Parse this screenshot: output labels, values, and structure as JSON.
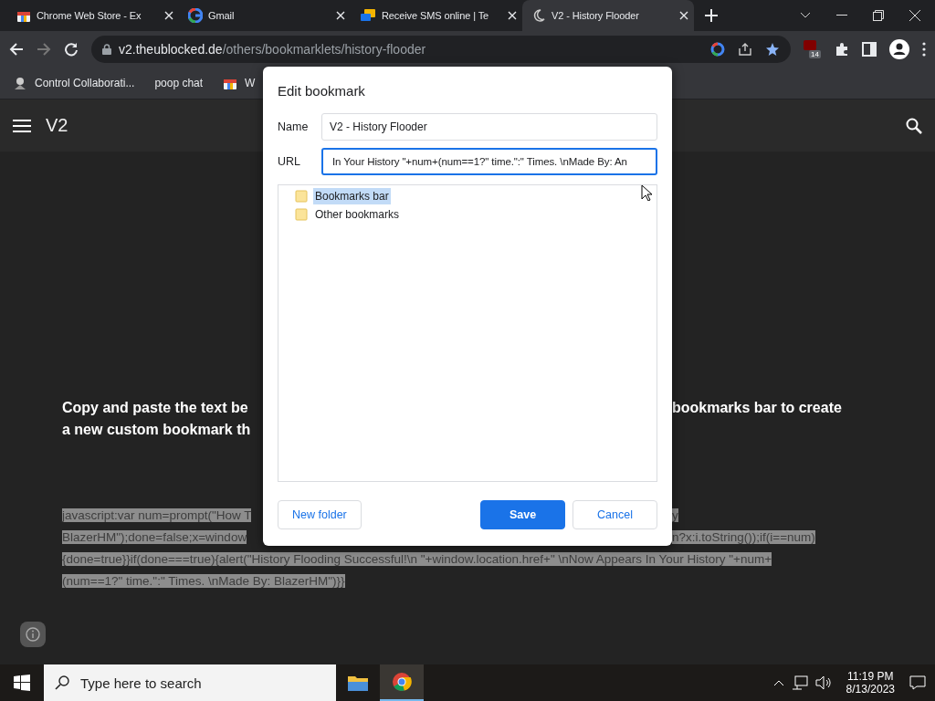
{
  "browser": {
    "tabs": [
      {
        "title": "Chrome Web Store - Ex",
        "kind": "store",
        "selected": false
      },
      {
        "title": "Gmail",
        "kind": "google",
        "selected": false
      },
      {
        "title": "Receive SMS online | Te",
        "kind": "sms",
        "selected": false
      },
      {
        "title": "V2 - History Flooder",
        "kind": "moon",
        "selected": true
      }
    ],
    "address": {
      "domain": "v2.theublocked.de",
      "path": "/others/bookmarklets/history-flooder"
    },
    "extension_badge": "14",
    "bookmarks": [
      {
        "label": "Control Collaborati...",
        "kind": "logo"
      },
      {
        "label": "poop chat",
        "kind": "plain"
      },
      {
        "label": "W",
        "kind": "store"
      }
    ]
  },
  "page": {
    "title": "V2",
    "instructions": [
      {
        "left": "Copy and paste the text be",
        "right": "bookmarks bar to create"
      },
      {
        "left": "a new custom bookmark th"
      }
    ],
    "code_lines": [
      {
        "left": "javascript:var num=prompt(\"How T",
        "right": "y"
      },
      {
        "left": "BlazerHM\");done=false;x=window",
        "right": "n?x:i.toString());if(i==num)"
      },
      {
        "left": "{done=true}}if(done===true){alert(\"History Flooding Successful!\\n \"+window.location.href+\" \\nNow Appears In Your History \"+num+"
      },
      {
        "left": "(num==1?\" time.\":\" Times. \\nMade By: BlazerHM\")}}"
      }
    ]
  },
  "dialog": {
    "title": "Edit bookmark",
    "fields": [
      {
        "label": "Name",
        "value": "V2 - History Flooder",
        "focused": false
      },
      {
        "label": "URL",
        "value": "In Your History \"+num+(num==1?\" time.\":\" Times. \\nMade By: An",
        "focused": true
      }
    ],
    "folders": [
      {
        "label": "Bookmarks bar",
        "selected": true
      },
      {
        "label": "Other bookmarks",
        "selected": false
      }
    ],
    "buttons": [
      {
        "label": "New folder",
        "kind": "secondary"
      },
      {
        "label": "Save",
        "kind": "primary"
      },
      {
        "label": "Cancel",
        "kind": "secondary"
      }
    ]
  },
  "taskbar": {
    "search_placeholder": "Type here to search",
    "time": "11:19 PM",
    "date": "8/13/2023"
  }
}
